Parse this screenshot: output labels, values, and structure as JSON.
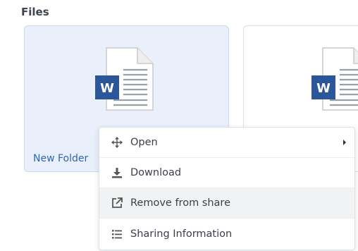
{
  "section": {
    "title": "Files"
  },
  "files": [
    {
      "name": "New Folder",
      "icon": "word-document-icon",
      "badge": "W"
    },
    {
      "name": "",
      "icon": "word-document-icon",
      "badge": "W"
    }
  ],
  "context_menu": {
    "items": [
      {
        "label": "Open",
        "icon": "move-arrows-icon",
        "has_submenu": true
      },
      {
        "label": "Download",
        "icon": "download-icon"
      },
      {
        "label": "Remove from share",
        "icon": "external-link-icon"
      },
      {
        "label": "Sharing Information",
        "icon": "list-icon"
      }
    ]
  },
  "colors": {
    "word_blue": "#2b579a",
    "selected_card_bg": "#e9f0fb",
    "link_blue": "#2f66b3"
  }
}
